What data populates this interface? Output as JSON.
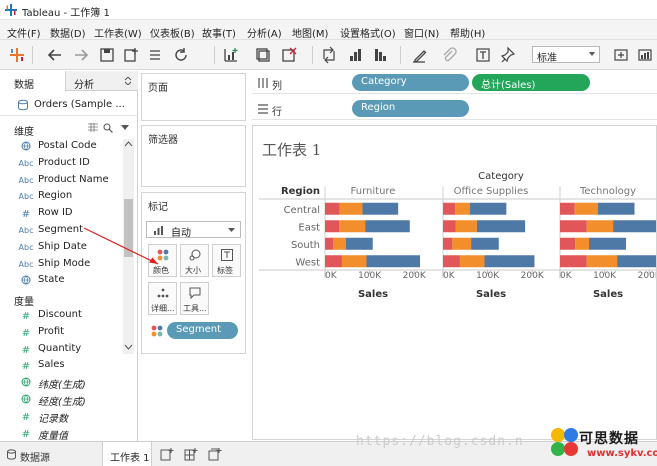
{
  "window": {
    "title": "Tableau - 工作簿 1"
  },
  "menu": [
    "文件(F)",
    "数据(D)",
    "工作表(W)",
    "仪表板(B)",
    "故事(T)",
    "分析(A)",
    "地图(M)",
    "设置格式(O)",
    "窗口(N)",
    "帮助(H)"
  ],
  "toolbar": {
    "fit_value": "标准"
  },
  "data_pane": {
    "tab_data": "数据",
    "tab_analysis": "分析",
    "datasource": "Orders (Sample ...",
    "dimensions_label": "维度",
    "dimensions": [
      {
        "icon": "globe",
        "type": "geo",
        "name": "Postal Code"
      },
      {
        "icon": "Abc",
        "type": "text",
        "name": "Product ID"
      },
      {
        "icon": "Abc",
        "type": "text",
        "name": "Product Name"
      },
      {
        "icon": "Abc",
        "type": "text",
        "name": "Region"
      },
      {
        "icon": "#",
        "type": "number",
        "name": "Row ID"
      },
      {
        "icon": "Abc",
        "type": "text",
        "name": "Segment"
      },
      {
        "icon": "Abc",
        "type": "text",
        "name": "Ship Date"
      },
      {
        "icon": "Abc",
        "type": "text",
        "name": "Ship Mode"
      },
      {
        "icon": "globe",
        "type": "geo",
        "name": "State"
      }
    ],
    "measures_label": "度量",
    "measures": [
      {
        "icon": "#",
        "type": "number",
        "name": "Discount"
      },
      {
        "icon": "#",
        "type": "number",
        "name": "Profit"
      },
      {
        "icon": "#",
        "type": "number",
        "name": "Quantity"
      },
      {
        "icon": "#",
        "type": "number",
        "name": "Sales"
      },
      {
        "icon": "globe",
        "type": "geo",
        "name": "纬度(生成)"
      },
      {
        "icon": "globe",
        "type": "geo",
        "name": "经度(生成)"
      },
      {
        "icon": "#",
        "type": "number",
        "name": "记录数"
      },
      {
        "icon": "#",
        "type": "number",
        "name": "度量值"
      }
    ]
  },
  "shelves": {
    "pages_label": "页面",
    "filters_label": "筛选器",
    "marks_label": "标记",
    "mark_type": "自动",
    "mark_buttons": [
      "颜色",
      "大小",
      "标签",
      "详细...",
      "工具..."
    ],
    "color_pill": "Segment",
    "columns_label": "列",
    "rows_label": "行",
    "columns_pills": [
      "Category",
      "总计(Sales)"
    ],
    "rows_pills": [
      "Region"
    ]
  },
  "sheet": {
    "title": "工作表 1"
  },
  "chart_data": {
    "type": "bar",
    "orientation": "horizontal",
    "stacked": true,
    "title": "",
    "column_header": "Category",
    "row_header": "Region",
    "panels": [
      "Furniture",
      "Office Supplies",
      "Technology"
    ],
    "categories": [
      "Central",
      "East",
      "South",
      "West"
    ],
    "xlabel": "Sales",
    "xticks": [
      "0K",
      "100K",
      "200K"
    ],
    "xlim": [
      0,
      260000
    ],
    "series_colors": {
      "Consumer": "#4e79a7",
      "Corporate": "#f28e2b",
      "Home Office": "#e15759"
    },
    "series": [
      {
        "values_by_panel": [
          [
            80000,
            100000,
            60000,
            120000
          ],
          [
            82000,
            108000,
            62000,
            112000
          ],
          [
            82000,
            133000,
            83000,
            158000
          ]
        ]
      },
      {
        "values_by_panel": [
          [
            51000,
            58000,
            29000,
            55000
          ],
          [
            33000,
            48000,
            42000,
            55000
          ],
          [
            52000,
            59000,
            31000,
            68000
          ]
        ]
      },
      {
        "values_by_panel": [
          [
            33000,
            32000,
            18000,
            38000
          ],
          [
            27000,
            28000,
            21000,
            38000
          ],
          [
            33000,
            60000,
            34000,
            60000
          ]
        ]
      }
    ]
  },
  "status_bar": {
    "datasource_tab": "数据源",
    "sheet_tab": "工作表 1"
  },
  "watermark": {
    "text": "https://blog.csdn.n",
    "brand": "可思数据",
    "brand_url": "www.sykv.com"
  }
}
